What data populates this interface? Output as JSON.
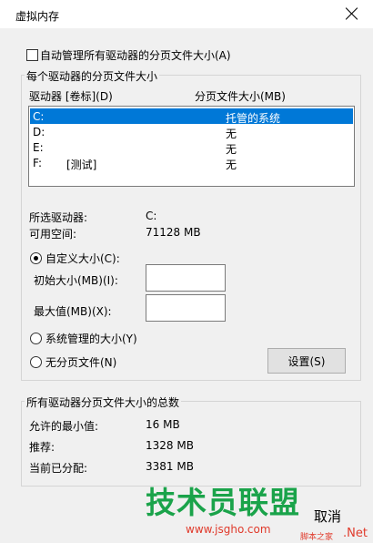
{
  "window": {
    "title": "虚拟内存"
  },
  "auto_manage": {
    "label": "自动管理所有驱动器的分页文件大小(A)",
    "checked": false
  },
  "group_each": {
    "title": "每个驱动器的分页文件大小",
    "col_drive": "驱动器 [卷标](D)",
    "col_size": "分页文件大小(MB)",
    "rows": [
      {
        "drive": "C:",
        "label": "",
        "size": "托管的系统",
        "selected": true
      },
      {
        "drive": "D:",
        "label": "",
        "size": "无"
      },
      {
        "drive": "E:",
        "label": "",
        "size": "无"
      },
      {
        "drive": "F:",
        "label": "[测试]",
        "size": "无"
      }
    ],
    "selected_drive_label": "所选驱动器:",
    "selected_drive_value": "C:",
    "free_space_label": "可用空间:",
    "free_space_value": "71128 MB",
    "custom_size": "自定义大小(C):",
    "initial_size": "初始大小(MB)(I):",
    "initial_value": "",
    "max_size": "最大值(MB)(X):",
    "max_value": "",
    "system_managed": "系统管理的大小(Y)",
    "no_paging": "无分页文件(N)",
    "set_button": "设置(S)"
  },
  "group_total": {
    "title": "所有驱动器分页文件大小的总数",
    "min_label": "允许的最小值:",
    "min_value": "16 MB",
    "recommended_label": "推荐:",
    "recommended_value": "1328 MB",
    "allocated_label": "当前已分配:",
    "allocated_value": "3381 MB"
  },
  "watermark": {
    "main": "技术员联盟",
    "url": "www.jsgho.com",
    "cancel_fragment": "取消",
    "site_small": "脚本之家",
    "site_net": ".Net"
  },
  "colors": {
    "selection": "#0078d7",
    "watermark_green": "#1aa34a",
    "watermark_red": "#e03a2b"
  }
}
